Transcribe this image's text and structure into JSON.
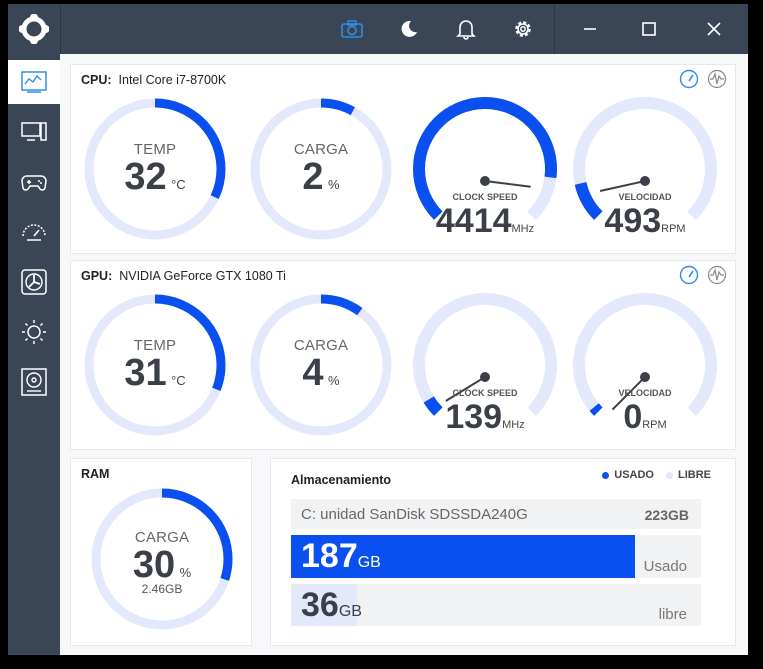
{
  "colors": {
    "accent": "#0a4ff0",
    "track": "#e3e9fa",
    "titlebar": "#3a4656"
  },
  "titlebar": {
    "icons": [
      "app-logo-icon",
      "camera-icon",
      "moon-icon",
      "bell-icon",
      "gear-icon",
      "minimize-icon",
      "maximize-icon",
      "close-icon"
    ]
  },
  "sidebar": {
    "items": [
      "dashboard-icon",
      "monitor-icon",
      "gamepad-icon",
      "speedometer-icon",
      "fan-icon",
      "sun-icon",
      "drive-icon"
    ]
  },
  "cpu": {
    "label": "CPU:",
    "name": "Intel Core i7-8700K",
    "temp": {
      "label": "TEMP",
      "value": "32",
      "unit": "°C",
      "fraction": 0.32
    },
    "load": {
      "label": "CARGA",
      "value": "2",
      "unit": "%",
      "fraction": 0.02
    },
    "clock": {
      "label": "CLOCK SPEED",
      "value": "4414",
      "unit": "MHz",
      "fraction": 0.86
    },
    "fan": {
      "label": "VELOCIDAD",
      "value": "493",
      "unit": "RPM",
      "fraction": 0.12
    }
  },
  "gpu": {
    "label": "GPU:",
    "name": "NVIDIA GeForce GTX 1080 Ti",
    "temp": {
      "label": "TEMP",
      "value": "31",
      "unit": "°C",
      "fraction": 0.31
    },
    "load": {
      "label": "CARGA",
      "value": "4",
      "unit": "%",
      "fraction": 0.04
    },
    "clock": {
      "label": "CLOCK SPEED",
      "value": "139",
      "unit": "MHz",
      "fraction": 0.05
    },
    "fan": {
      "label": "VELOCIDAD",
      "value": "0",
      "unit": "RPM",
      "fraction": 0.0
    }
  },
  "ram": {
    "title": "RAM",
    "label": "CARGA",
    "value": "30",
    "unit": "%",
    "sub": "2.46GB",
    "fraction": 0.3
  },
  "storage": {
    "title": "Almacenamiento",
    "legend_used": "USADO",
    "legend_free": "LIBRE",
    "drive_name": "C: unidad SanDisk SDSSDA240G",
    "drive_total": "223GB",
    "used_value": "187",
    "used_unit": "GB",
    "used_label": "Usado",
    "used_fraction": 0.8386,
    "free_value": "36",
    "free_unit": "GB",
    "free_label": "libre",
    "free_fraction": 0.1614
  }
}
